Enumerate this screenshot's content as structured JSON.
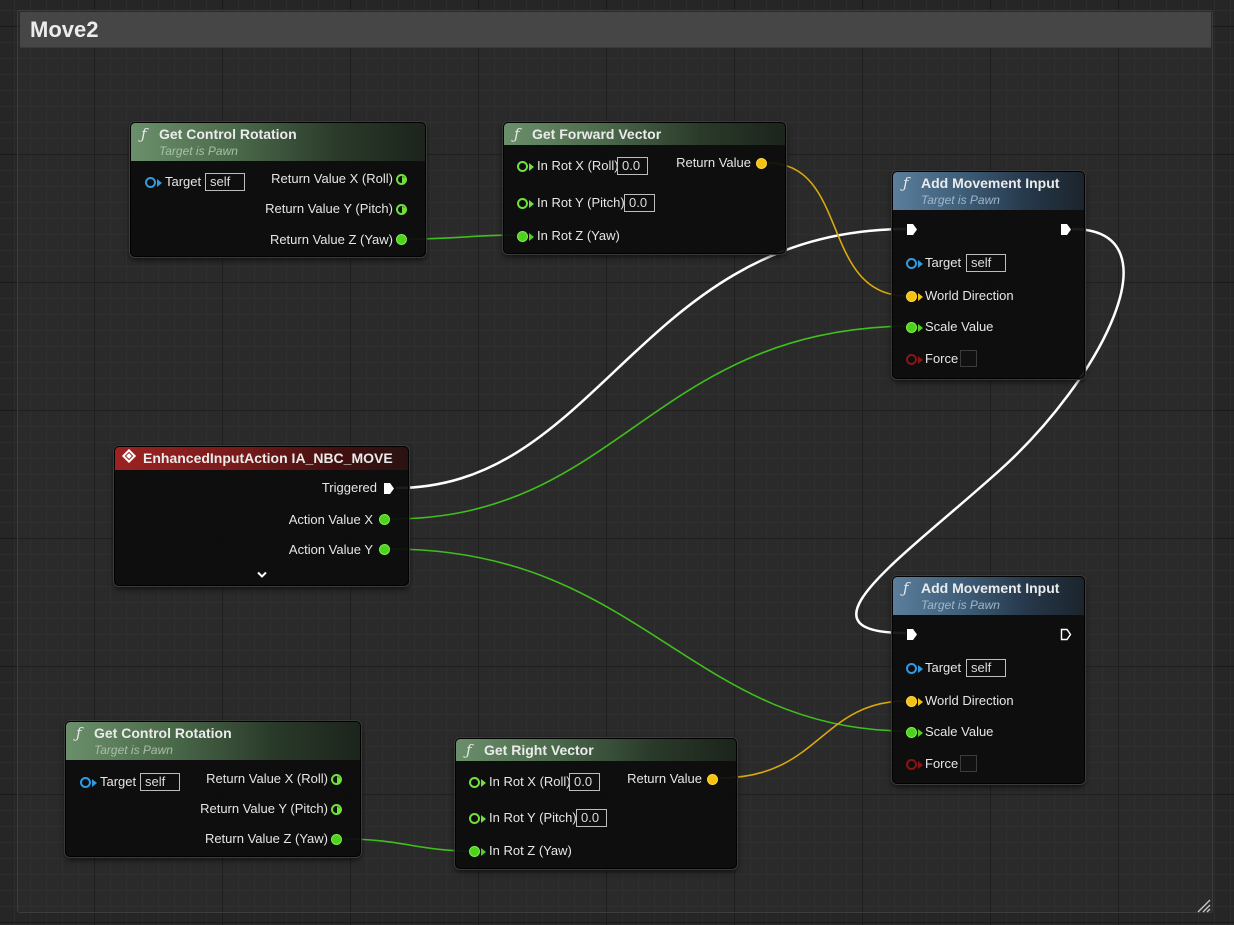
{
  "graph": {
    "comment_title": "Move2",
    "colors": {
      "exec": "#ffffff",
      "float": "#4fd21e",
      "vector": "#f5c20f",
      "object": "#2f9be0",
      "bool": "#8a1515",
      "function_header": "#6b8f6b",
      "target_header": "#5a7e9c",
      "event_header": "#9c2222"
    }
  },
  "nodes": {
    "get_control_rotation_1": {
      "title": "Get Control Rotation",
      "subtitle": "Target is Pawn",
      "icon": "function-icon",
      "target_label": "Target",
      "target_value": "self",
      "out_x": "Return Value X (Roll)",
      "out_y": "Return Value Y (Pitch)",
      "out_z": "Return Value Z (Yaw)"
    },
    "get_forward_vector": {
      "title": "Get Forward Vector",
      "icon": "function-icon",
      "in_x": "In Rot X (Roll)",
      "in_x_value": "0.0",
      "in_y": "In Rot Y (Pitch)",
      "in_y_value": "0.0",
      "in_z": "In Rot Z (Yaw)",
      "out": "Return Value"
    },
    "add_movement_input_1": {
      "title": "Add Movement Input",
      "subtitle": "Target is Pawn",
      "icon": "function-icon",
      "target_label": "Target",
      "target_value": "self",
      "world_direction": "World Direction",
      "scale_value": "Scale Value",
      "force": "Force"
    },
    "enhanced_input_action": {
      "title": "EnhancedInputAction IA_NBC_MOVE",
      "icon": "event-icon",
      "triggered": "Triggered",
      "action_x": "Action Value X",
      "action_y": "Action Value Y"
    },
    "add_movement_input_2": {
      "title": "Add Movement Input",
      "subtitle": "Target is Pawn",
      "icon": "function-icon",
      "target_label": "Target",
      "target_value": "self",
      "world_direction": "World Direction",
      "scale_value": "Scale Value",
      "force": "Force"
    },
    "get_control_rotation_2": {
      "title": "Get Control Rotation",
      "subtitle": "Target is Pawn",
      "icon": "function-icon",
      "target_label": "Target",
      "target_value": "self",
      "out_x": "Return Value X (Roll)",
      "out_y": "Return Value Y (Pitch)",
      "out_z": "Return Value Z (Yaw)"
    },
    "get_right_vector": {
      "title": "Get Right Vector",
      "icon": "function-icon",
      "in_x": "In Rot X (Roll)",
      "in_x_value": "0.0",
      "in_y": "In Rot Y (Pitch)",
      "in_y_value": "0.0",
      "in_z": "In Rot Z (Yaw)",
      "out": "Return Value"
    }
  }
}
